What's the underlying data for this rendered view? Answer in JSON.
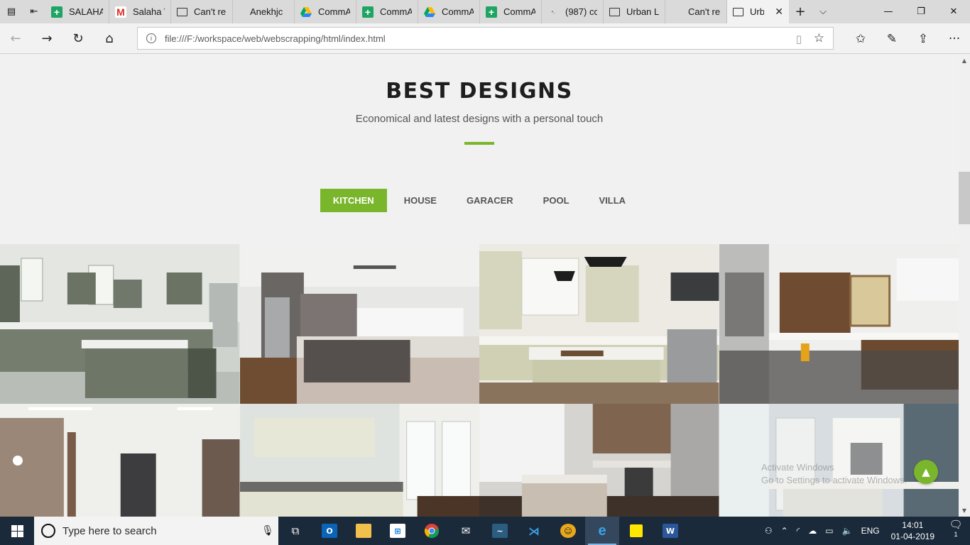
{
  "browser": {
    "tabs": [
      {
        "label": "SALAHA",
        "icon": "sheets-icon",
        "active": false
      },
      {
        "label": "Salaha \\",
        "icon": "gmail-icon",
        "active": false
      },
      {
        "label": "Can't re",
        "icon": "page-icon",
        "active": false
      },
      {
        "label": "Anekhjc",
        "icon": "blank-icon",
        "active": false
      },
      {
        "label": "CommA",
        "icon": "drive-icon",
        "active": false
      },
      {
        "label": "CommA",
        "icon": "sheets-icon",
        "active": false
      },
      {
        "label": "CommA",
        "icon": "drive-icon",
        "active": false
      },
      {
        "label": "CommA",
        "icon": "sheets-icon",
        "active": false
      },
      {
        "label": "(987) cc",
        "icon": "loading-icon",
        "active": false
      },
      {
        "label": "Urban L",
        "icon": "page-icon",
        "active": false
      },
      {
        "label": "Can't re",
        "icon": "blank-icon",
        "active": false
      },
      {
        "label": "Urb",
        "icon": "page-icon",
        "active": true
      }
    ],
    "url": "file:///F:/workspace/web/webscrapping/html/index.html"
  },
  "page": {
    "title": "BEST DESIGNS",
    "subtitle": "Economical and latest designs with a personal touch",
    "filters": [
      {
        "label": "KITCHEN",
        "active": true
      },
      {
        "label": "HOUSE",
        "active": false
      },
      {
        "label": "GARACER",
        "active": false
      },
      {
        "label": "POOL",
        "active": false
      },
      {
        "label": "VILLA",
        "active": false
      }
    ],
    "gallery_alt": [
      "Kitchen design 1",
      "Kitchen design 2",
      "Kitchen design 3",
      "Kitchen design 4",
      "Kitchen design 5",
      "Kitchen design 6",
      "Kitchen design 7",
      "Kitchen design 8"
    ],
    "watermark_line1": "Activate Windows",
    "watermark_line2": "Go to Settings to activate Windows.",
    "accent_color": "#7ab62c"
  },
  "taskbar": {
    "search_placeholder": "Type here to search",
    "language": "ENG",
    "time": "14:01",
    "date": "01-04-2019",
    "notification_count": "1"
  }
}
